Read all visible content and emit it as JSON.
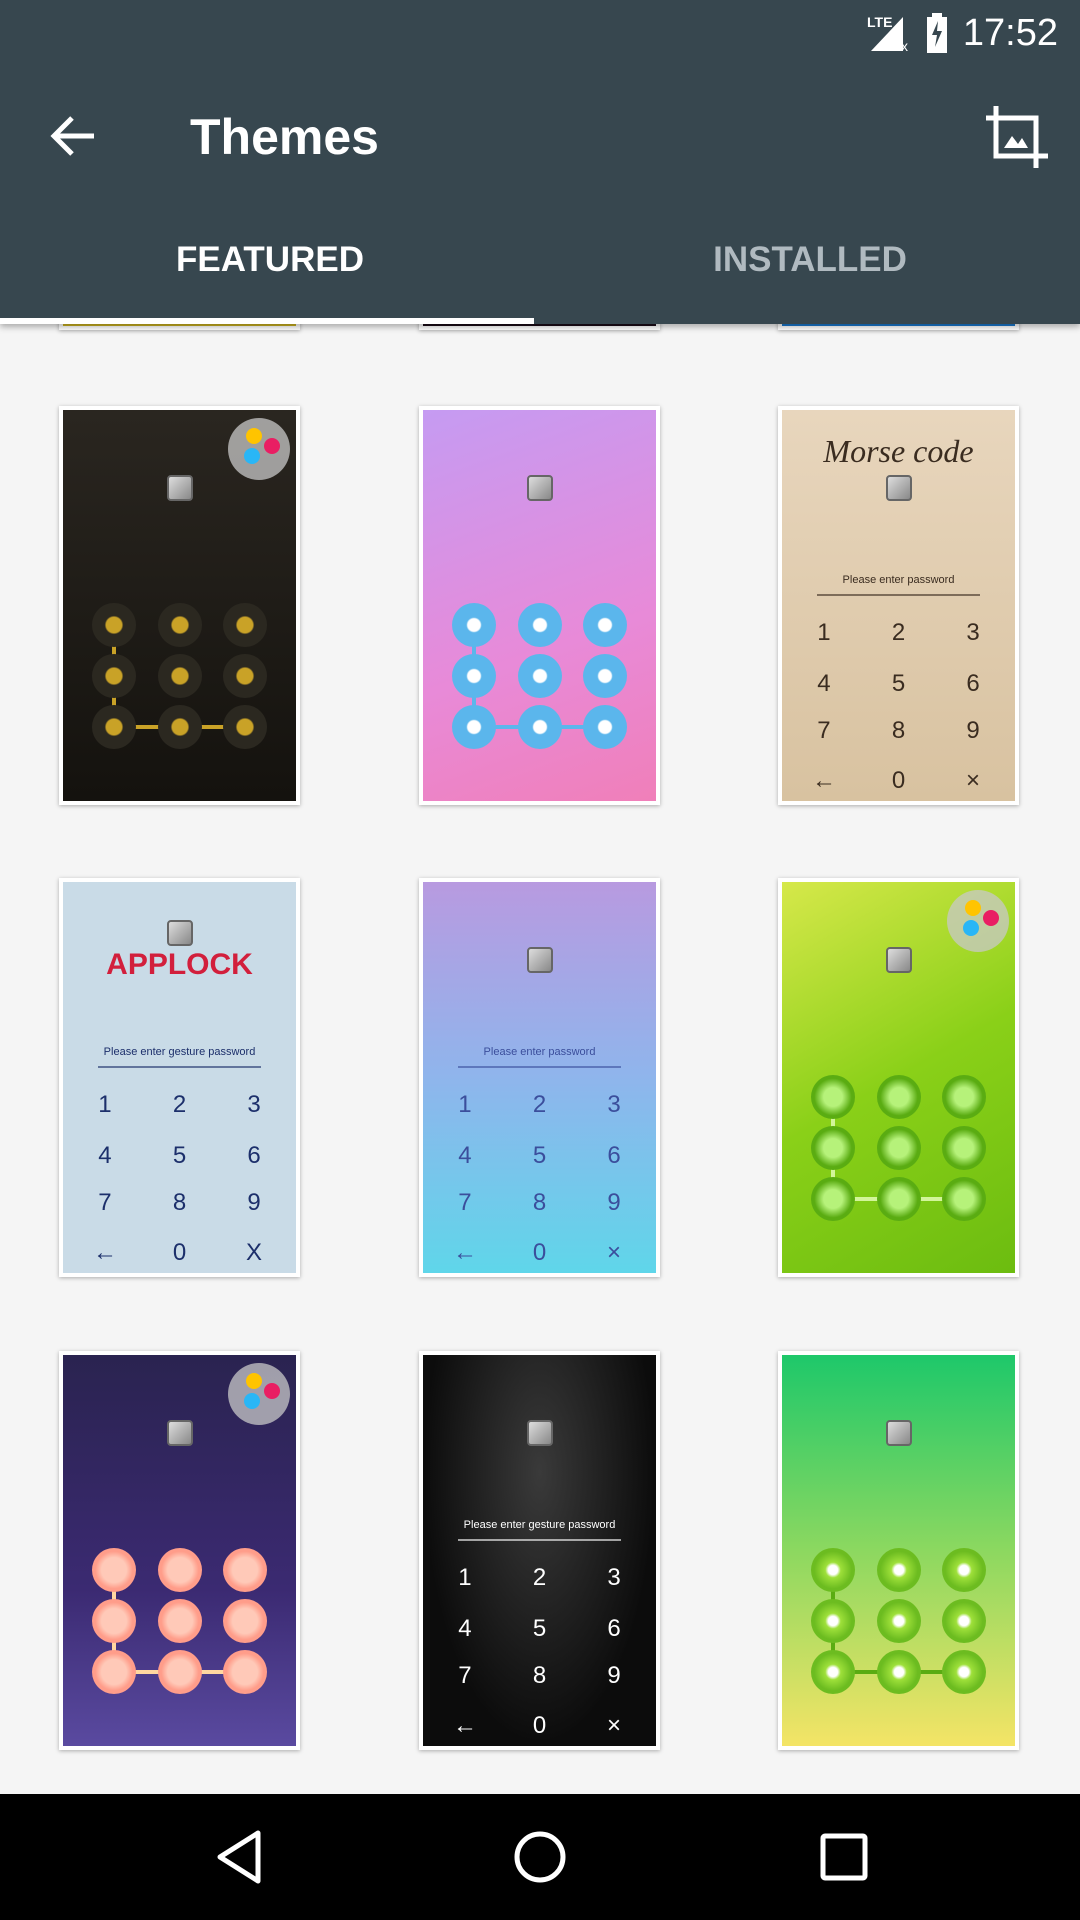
{
  "status_bar": {
    "network": "LTE",
    "time": "17:52",
    "icons": [
      "signal-lte-no-data-icon",
      "battery-charging-icon"
    ]
  },
  "toolbar": {
    "title": "Themes",
    "back_icon": "arrow-back-icon",
    "action_icon": "crop-image-icon"
  },
  "tabs": [
    {
      "label": "FEATURED",
      "active": true
    },
    {
      "label": "INSTALLED",
      "active": false
    }
  ],
  "colors": {
    "header": "#37474f",
    "tab_inactive": "#b0bac0",
    "background": "#f5f5f5"
  },
  "themes": [
    {
      "type": "pattern",
      "bg": "linear-gradient(#2a2620,#14120e)",
      "dot": "radial-gradient(#c9a227 25%,#2b2820 30%)",
      "line": "#c9a227",
      "palette": true,
      "header": "",
      "prompt": ""
    },
    {
      "type": "pattern",
      "bg": "linear-gradient(160deg,#c59bf2,#e88ad8 60%,#f07fb9)",
      "dot": "radial-gradient(#fff 20%,#5bb6ec 25%)",
      "line": "#5bb6ec",
      "palette": false,
      "header": "",
      "prompt": ""
    },
    {
      "type": "keypad",
      "bg": "linear-gradient(#e8d6bd,#d8c2a0)",
      "fg": "#3a2c20",
      "palette": false,
      "header": "Morse code",
      "prompt": "Please enter password",
      "keys": [
        "1",
        "2",
        "3",
        "4",
        "5",
        "6",
        "7",
        "8",
        "9",
        "←",
        "0",
        "×"
      ]
    },
    {
      "type": "keypad",
      "bg": "#c9dbe7",
      "fg": "#1c2f6b",
      "palette": false,
      "header": "APPLOCK",
      "prompt": "Please enter gesture password",
      "keys": [
        "1",
        "2",
        "3",
        "4",
        "5",
        "6",
        "7",
        "8",
        "9",
        "←",
        "0",
        "X"
      ]
    },
    {
      "type": "keypad",
      "bg": "linear-gradient(#b89ae0,#8fb5ec 50%,#5fd6ea)",
      "fg": "#3b4e9c",
      "palette": false,
      "header": "",
      "prompt": "Please enter password",
      "keys": [
        "1",
        "2",
        "3",
        "4",
        "5",
        "6",
        "7",
        "8",
        "9",
        "←",
        "0",
        "×"
      ]
    },
    {
      "type": "pattern",
      "bg": "linear-gradient(150deg,#d6e84a,#8ad018 50%,#6cbc10)",
      "dot": "radial-gradient(#b6f27a 30%,#5aac12 60%)",
      "line": "#d2f59a",
      "palette": true,
      "header": "",
      "prompt": ""
    },
    {
      "type": "pattern",
      "bg": "linear-gradient(#2a2350,#3b2a72 60%,#5a4aa0)",
      "dot": "radial-gradient(#ffc9b8 40%,#ff9d8a 60%)",
      "line": "#ffd7a0",
      "palette": true,
      "header": "",
      "prompt": ""
    },
    {
      "type": "keypad",
      "bg": "radial-gradient(ellipse at 50% 30%,#3a3a3a,#0c0c0c 70%)",
      "fg": "#ffffff",
      "palette": false,
      "header": "",
      "prompt": "Please enter gesture password",
      "keys": [
        "1",
        "2",
        "3",
        "4",
        "5",
        "6",
        "7",
        "8",
        "9",
        "←",
        "0",
        "×"
      ]
    },
    {
      "type": "pattern",
      "bg": "linear-gradient(#1ec86a,#8cd860 50%,#f4e466)",
      "dot": "radial-gradient(#fff 15%,#9ee03a 25%,#6cbc20 60%)",
      "line": "#5aac12",
      "palette": false,
      "header": "",
      "prompt": ""
    }
  ],
  "navbar": {
    "icons": [
      "back-triangle-icon",
      "home-circle-icon",
      "recents-square-icon"
    ]
  }
}
